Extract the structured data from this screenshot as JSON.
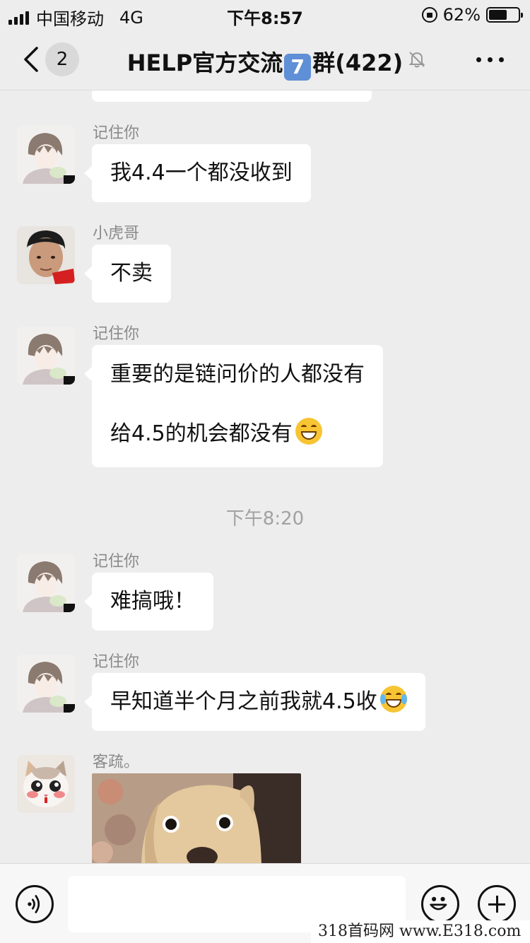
{
  "status_bar": {
    "carrier": "中国移动",
    "network": "4G",
    "time": "下午8:57",
    "battery_percent": "62%",
    "battery_level": 0.62
  },
  "nav": {
    "back_icon": "chevron-left-icon",
    "unread_count": "2",
    "title_prefix": "HELP官方交流",
    "title_number": "7",
    "title_suffix": "群(422)",
    "mute_icon": "bell-off-icon",
    "more_icon": "more-dots-icon"
  },
  "messages": [
    {
      "sender": "记住你",
      "text": "我4.4一个都没收到"
    },
    {
      "sender": "小虎哥",
      "text": "不卖"
    },
    {
      "sender": "记住你",
      "line1": "重要的是链问价的人都没有",
      "line2": "给4.5的机会都没有"
    },
    {
      "sender": "记住你",
      "text": "难搞哦！"
    },
    {
      "sender": "记住你",
      "text": "早知道半个月之前我就4.5收"
    },
    {
      "sender": "客疏。",
      "text": ""
    }
  ],
  "timestamp": "下午8:20",
  "input_bar": {
    "voice_icon": "voice-icon",
    "emoji_icon": "emoji-icon",
    "plus_icon": "plus-icon",
    "value": ""
  },
  "watermark": "318首码网  www.E318.com",
  "colors": {
    "background": "#ededed",
    "bubble": "#ffffff",
    "sender": "#8a8a8a",
    "number_badge": "#5f8fd6"
  }
}
